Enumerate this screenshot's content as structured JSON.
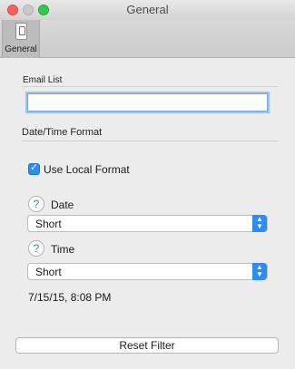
{
  "window": {
    "title": "General"
  },
  "toolbar": {
    "items": [
      {
        "label": "General",
        "icon": "general-prefs-icon"
      }
    ]
  },
  "email": {
    "label": "Email List",
    "value": "",
    "placeholder": ""
  },
  "datetime": {
    "section_title": "Date/Time Format",
    "use_local": {
      "label": "Use Local Format",
      "checked": true
    },
    "date": {
      "help": "?",
      "label": "Date",
      "selected": "Short"
    },
    "time": {
      "help": "?",
      "label": "Time",
      "selected": "Short"
    },
    "preview": "7/15/15, 8:08 PM"
  },
  "actions": {
    "reset_label": "Reset Filter"
  }
}
